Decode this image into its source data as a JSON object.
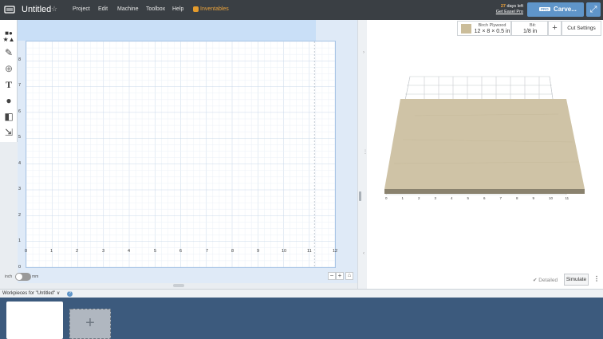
{
  "header": {
    "title": "Untitled",
    "menu": [
      "Project",
      "Edit",
      "Machine",
      "Toolbox",
      "Help"
    ],
    "inventables": "Inventables",
    "trial_days": "27",
    "trial_suffix": "days left",
    "trial_link": "Get Easel Pro",
    "pro_badge": "PRO",
    "carve_label": "Carve...",
    "expand_icon": "expand-icon"
  },
  "design": {
    "x_ticks": [
      "0",
      "1",
      "2",
      "3",
      "4",
      "5",
      "6",
      "7",
      "8",
      "9",
      "10",
      "11",
      "12"
    ],
    "y_ticks": [
      "0",
      "1",
      "2",
      "3",
      "4",
      "5",
      "6",
      "7",
      "8"
    ],
    "unit_inch": "inch",
    "unit_mm": "mm"
  },
  "preview": {
    "material_name": "Birch Plywood",
    "material_size": "12 × 8 × 0.5 in",
    "bit_label": "Bit:",
    "bit_value": "1/8 in",
    "add_symbol": "+",
    "cut_settings": "Cut Settings",
    "detailed_label": "✔ Detailed",
    "simulate_label": "Simulate",
    "more_symbol": "⋮",
    "axis_ticks": [
      "0",
      "1",
      "2",
      "3",
      "4",
      "5",
      "6",
      "7",
      "8",
      "9",
      "10",
      "11"
    ],
    "wood_color": "#cfc3a6",
    "wood_edge_color": "#8a826e"
  },
  "workpieces": {
    "label": "Workpieces for \"Untitled\"",
    "chevron": "∨",
    "help": "?",
    "add_symbol": "+"
  },
  "colors": {
    "topbar": "#3a3f44",
    "accent": "#5f95c9",
    "inventables": "#e9a23b",
    "workpiece_panel": "#3c5a7d"
  }
}
